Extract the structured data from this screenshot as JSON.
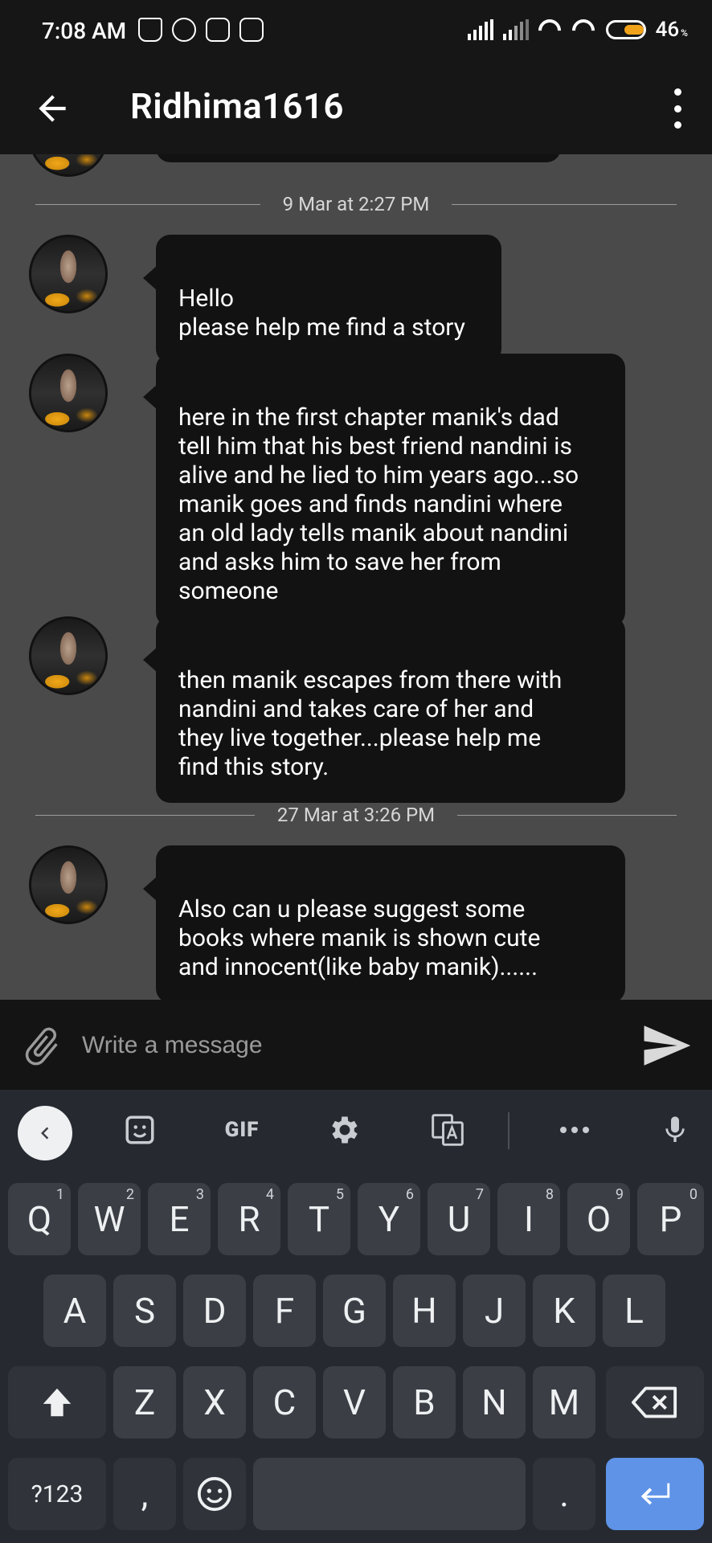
{
  "status": {
    "time": "7:08 AM",
    "battery": "46",
    "battery_unit": "%"
  },
  "header": {
    "title": "Ridhima1616"
  },
  "chat": {
    "date_1": "9 Mar at 2:27 PM",
    "date_2": "27 Mar at 3:26 PM",
    "messages": [
      {
        "text": "Hello\nplease help me find a story"
      },
      {
        "text": "here in the first chapter manik's dad\ntell him that his best friend nandini is\nalive and he lied to him years ago...so\nmanik goes and finds nandini where\nan old lady tells manik about nandini\nand asks him to save her from\nsomeone"
      },
      {
        "text": "then manik escapes from there with\nnandini and takes care of her and\nthey live together...please help me\nfind this story."
      },
      {
        "text": "Also can u please suggest some\nbooks where manik is shown cute\nand innocent(like baby manik)......"
      }
    ]
  },
  "composer": {
    "placeholder": "Write a message"
  },
  "keyboard": {
    "toolbar": {
      "gif": "GIF"
    },
    "row1": [
      {
        "k": "Q",
        "n": "1"
      },
      {
        "k": "W",
        "n": "2"
      },
      {
        "k": "E",
        "n": "3"
      },
      {
        "k": "R",
        "n": "4"
      },
      {
        "k": "T",
        "n": "5"
      },
      {
        "k": "Y",
        "n": "6"
      },
      {
        "k": "U",
        "n": "7"
      },
      {
        "k": "I",
        "n": "8"
      },
      {
        "k": "O",
        "n": "9"
      },
      {
        "k": "P",
        "n": "0"
      }
    ],
    "row2": [
      "A",
      "S",
      "D",
      "F",
      "G",
      "H",
      "J",
      "K",
      "L"
    ],
    "row3": [
      "Z",
      "X",
      "C",
      "V",
      "B",
      "N",
      "M"
    ],
    "symbols": "?123",
    "comma": ",",
    "period": "."
  }
}
